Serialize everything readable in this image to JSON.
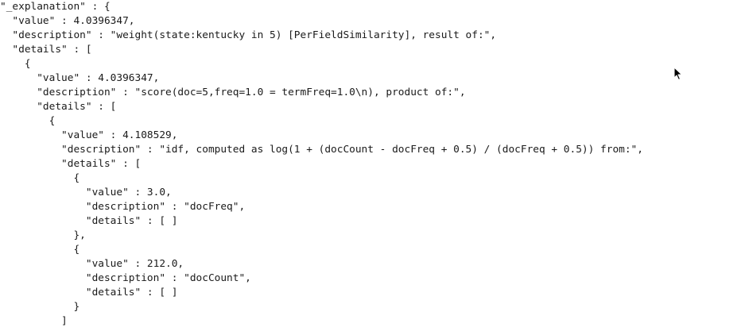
{
  "json_view": {
    "lines": [
      "\"_explanation\" : {",
      "  \"value\" : 4.0396347,",
      "  \"description\" : \"weight(state:kentucky in 5) [PerFieldSimilarity], result of:\",",
      "  \"details\" : [",
      "    {",
      "      \"value\" : 4.0396347,",
      "      \"description\" : \"score(doc=5,freq=1.0 = termFreq=1.0\\n), product of:\",",
      "      \"details\" : [",
      "        {",
      "          \"value\" : 4.108529,",
      "          \"description\" : \"idf, computed as log(1 + (docCount - docFreq + 0.5) / (docFreq + 0.5)) from:\",",
      "          \"details\" : [",
      "            {",
      "              \"value\" : 3.0,",
      "              \"description\" : \"docFreq\",",
      "              \"details\" : [ ]",
      "            },",
      "            {",
      "              \"value\" : 212.0,",
      "              \"description\" : \"docCount\",",
      "              \"details\" : [ ]",
      "            }",
      "          ]",
      "        },"
    ]
  },
  "cursor": {
    "icon": "arrow-pointer-icon"
  }
}
